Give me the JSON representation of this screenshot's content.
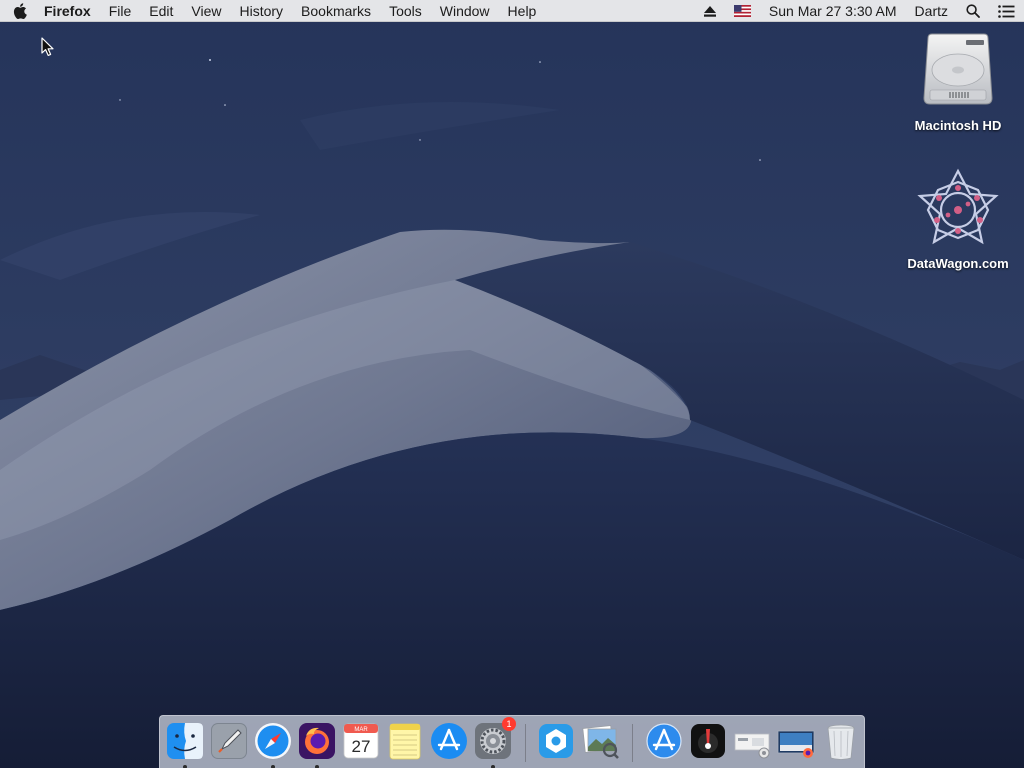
{
  "menubar": {
    "app_name": "Firefox",
    "menus": [
      "File",
      "Edit",
      "View",
      "History",
      "Bookmarks",
      "Tools",
      "Window",
      "Help"
    ],
    "status": {
      "date_time": "Sun Mar 27  3:30 AM",
      "user": "Dartz"
    }
  },
  "desktop": {
    "icons": [
      {
        "label": "Macintosh HD",
        "icon": "hard-drive-icon"
      },
      {
        "label": "DataWagon.com",
        "icon": "datawagon-icon"
      }
    ]
  },
  "dock": {
    "items": [
      {
        "name": "Finder",
        "icon": "finder-icon",
        "running": true
      },
      {
        "name": "Launchpad",
        "icon": "launchpad-icon",
        "running": false
      },
      {
        "name": "Safari",
        "icon": "safari-icon",
        "running": true
      },
      {
        "name": "Firefox",
        "icon": "firefox-icon",
        "running": true
      },
      {
        "name": "Calendar",
        "icon": "calendar-icon",
        "running": false,
        "month": "MAR",
        "day": "27"
      },
      {
        "name": "Notes",
        "icon": "notes-icon",
        "running": false
      },
      {
        "name": "App Store",
        "icon": "app-store-icon",
        "running": false
      },
      {
        "name": "System Preferences",
        "icon": "system-preferences-icon",
        "running": true,
        "badge": "1"
      },
      {
        "name": "Self Service",
        "icon": "self-service-icon",
        "running": false
      },
      {
        "name": "Preview",
        "icon": "preview-icon",
        "running": false
      },
      {
        "name": "Applications",
        "icon": "applications-folder-icon",
        "running": false
      },
      {
        "name": "Instruments",
        "icon": "instruments-icon",
        "running": false
      },
      {
        "name": "Documents",
        "icon": "documents-stack-icon",
        "running": false
      },
      {
        "name": "Downloads",
        "icon": "downloads-stack-icon",
        "running": false
      },
      {
        "name": "Trash",
        "icon": "trash-icon",
        "running": false
      }
    ]
  }
}
